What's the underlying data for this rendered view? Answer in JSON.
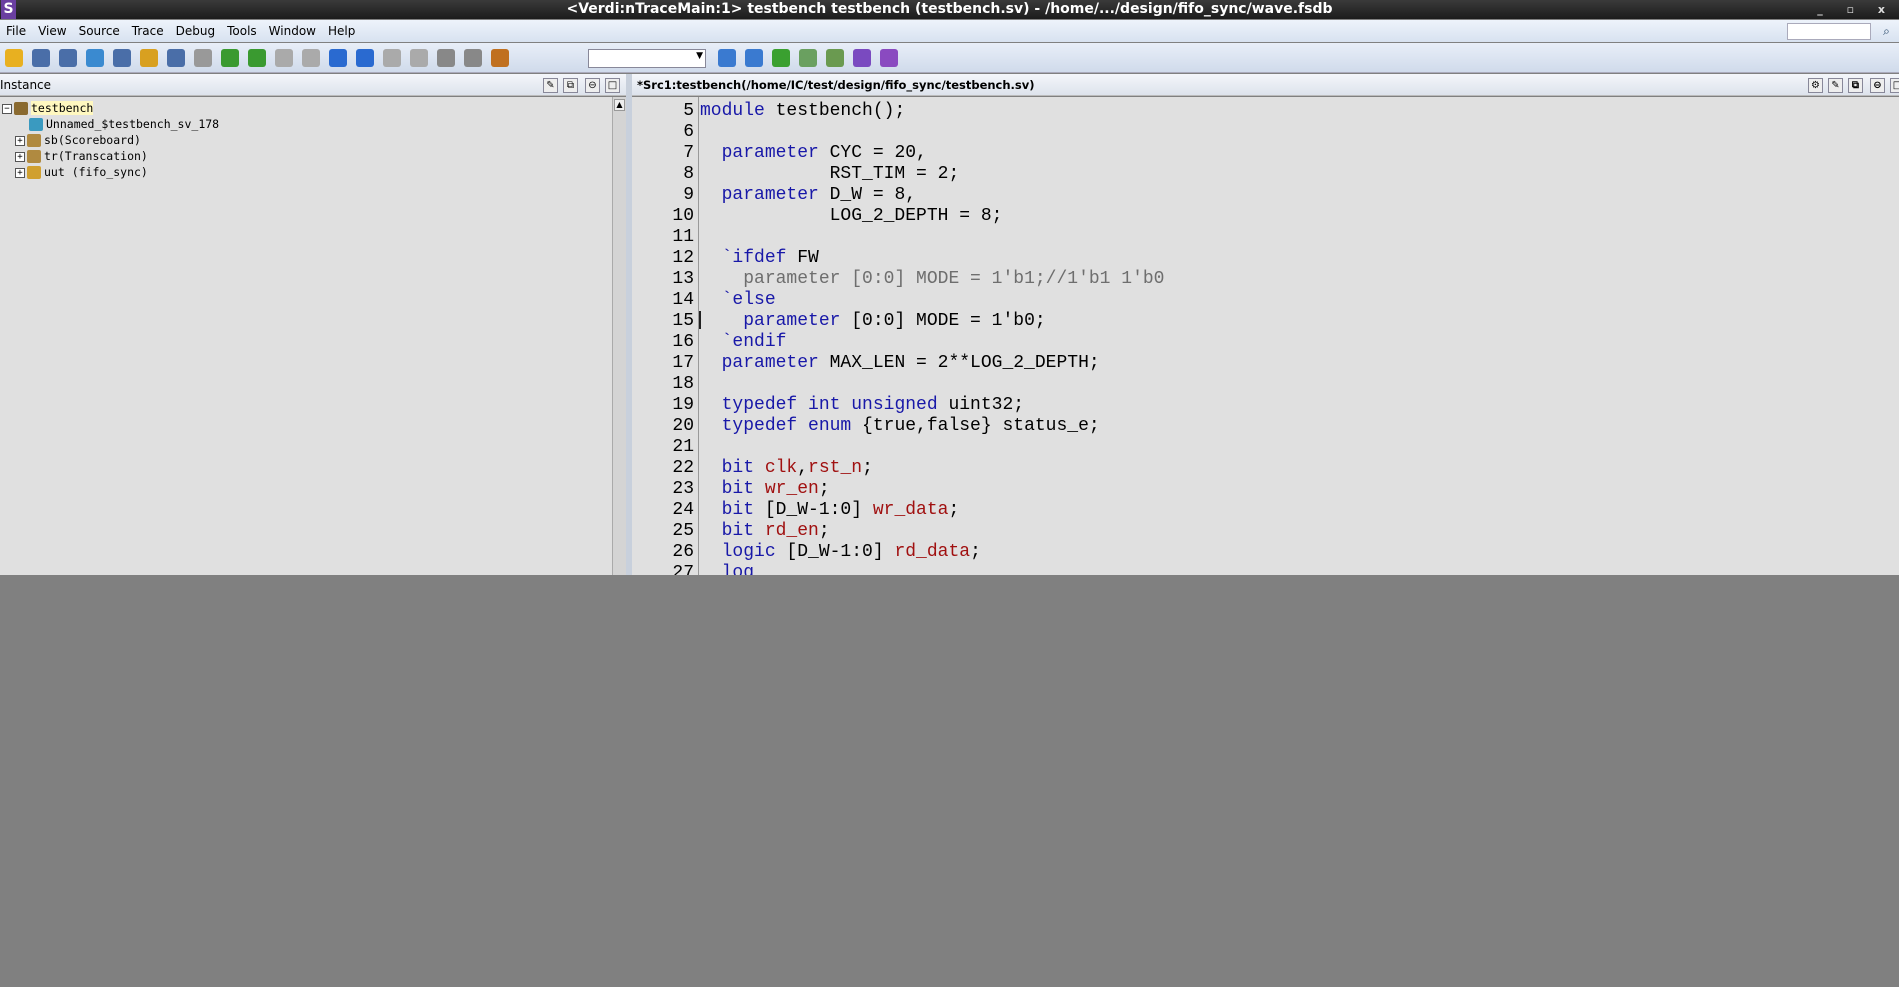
{
  "window": {
    "title": "<Verdi:nTraceMain:1> testbench testbench (testbench.sv) - /home/.../design/fifo_sync/wave.fsdb",
    "logo": "S"
  },
  "menu": [
    "File",
    "View",
    "Source",
    "Trace",
    "Debug",
    "Tools",
    "Window",
    "Help"
  ],
  "toolbar": {
    "icons": [
      "open-folder-icon",
      "schematic-icon",
      "design-icon",
      "hierarchy-icon",
      "notes-icon",
      "folder-icon",
      "edit-icon",
      "paste-icon",
      "trace-load-icon",
      "trace-driver-icon",
      "back-arrow-icon",
      "forward-arrow-icon",
      "driver-icon",
      "load-icon",
      "up-icon",
      "down-icon",
      "expand-icon",
      "collapse-icon",
      "bookmark-icon",
      "find-icon",
      "zoom-find-icon",
      "e-icon",
      "refresh-icon",
      "add-icon",
      "uvm-icon",
      "apps-icon"
    ],
    "combo_value": ""
  },
  "instance_panel": {
    "title": "Instance",
    "tree": [
      {
        "label": "testbench",
        "level": 0,
        "expander": "minus",
        "highlight": true
      },
      {
        "label": "Unnamed_$testbench_sv_178",
        "level": 1,
        "expander": "none"
      },
      {
        "label": "sb(Scoreboard)",
        "level": 1,
        "expander": "plus"
      },
      {
        "label": "tr(Transcation)",
        "level": 1,
        "expander": "plus"
      },
      {
        "label": "uut (fifo_sync)",
        "level": 1,
        "expander": "plus"
      }
    ]
  },
  "source_panel": {
    "title": "*Src1:testbench(/home/IC/test/design/fifo_sync/testbench.sv)",
    "lines": [
      {
        "n": "5",
        "tokens": [
          [
            "kw",
            "module"
          ],
          [
            "",
            "testbench();"
          ]
        ],
        "indent": 0,
        "sep": " "
      },
      {
        "n": "6",
        "tokens": [],
        "indent": 0
      },
      {
        "n": "7",
        "tokens": [
          [
            "kw",
            "parameter"
          ],
          [
            "",
            " CYC = 20,"
          ]
        ],
        "indent": 2
      },
      {
        "n": "8",
        "tokens": [
          [
            "",
            "RST_TIM = 2;"
          ]
        ],
        "indent": 12
      },
      {
        "n": "9",
        "tokens": [
          [
            "kw",
            "parameter"
          ],
          [
            "",
            " D_W = 8,"
          ]
        ],
        "indent": 2
      },
      {
        "n": "10",
        "tokens": [
          [
            "",
            "LOG_2_DEPTH = 8;"
          ]
        ],
        "indent": 12
      },
      {
        "n": "11",
        "tokens": [],
        "indent": 0
      },
      {
        "n": "12",
        "tokens": [
          [
            "kw",
            "`ifdef"
          ],
          [
            "",
            " FW"
          ]
        ],
        "indent": 2
      },
      {
        "n": "13",
        "tokens": [
          [
            "inact",
            "parameter [0:0] MODE = 1'b1;//1'b1 1'b0"
          ]
        ],
        "indent": 4
      },
      {
        "n": "14",
        "tokens": [
          [
            "kw",
            "`else"
          ]
        ],
        "indent": 2
      },
      {
        "n": "15",
        "tokens": [
          [
            "kw",
            "parameter"
          ],
          [
            "",
            " [0:0] MODE = 1'b0;"
          ]
        ],
        "indent": 4
      },
      {
        "n": "16",
        "tokens": [
          [
            "kw",
            "`endif"
          ]
        ],
        "indent": 2
      },
      {
        "n": "17",
        "tokens": [
          [
            "kw",
            "parameter"
          ],
          [
            "",
            " MAX_LEN = 2**LOG_2_DEPTH;"
          ]
        ],
        "indent": 2
      },
      {
        "n": "18",
        "tokens": [],
        "indent": 0
      },
      {
        "n": "19",
        "tokens": [
          [
            "kw",
            "typedef int unsigned"
          ],
          [
            "",
            " uint32;"
          ]
        ],
        "indent": 2
      },
      {
        "n": "20",
        "tokens": [
          [
            "kw",
            "typedef enum"
          ],
          [
            "",
            " {true,false} status_e;"
          ]
        ],
        "indent": 2
      },
      {
        "n": "21",
        "tokens": [],
        "indent": 0
      },
      {
        "n": "22",
        "tokens": [
          [
            "kw",
            "bit"
          ],
          [
            "",
            " "
          ],
          [
            "sig",
            "clk"
          ],
          [
            "",
            ","
          ],
          [
            "sig",
            "rst_n"
          ],
          [
            "",
            ";"
          ]
        ],
        "indent": 2
      },
      {
        "n": "23",
        "tokens": [
          [
            "kw",
            "bit"
          ],
          [
            "",
            " "
          ],
          [
            "sig",
            "wr_en"
          ],
          [
            "",
            ";"
          ]
        ],
        "indent": 2
      },
      {
        "n": "24",
        "tokens": [
          [
            "kw",
            "bit"
          ],
          [
            "",
            " [D_W-1:0] "
          ],
          [
            "sig",
            "wr_data"
          ],
          [
            "",
            ";"
          ]
        ],
        "indent": 2
      },
      {
        "n": "25",
        "tokens": [
          [
            "kw",
            "bit"
          ],
          [
            "",
            " "
          ],
          [
            "sig",
            "rd_en"
          ],
          [
            "",
            ";"
          ]
        ],
        "indent": 2
      },
      {
        "n": "26",
        "tokens": [
          [
            "kw",
            "logic"
          ],
          [
            "",
            " [D_W-1:0] "
          ],
          [
            "sig",
            "rd_data"
          ],
          [
            "",
            ";"
          ]
        ],
        "indent": 2
      },
      {
        "n": "27",
        "tokens": [
          [
            "kw",
            "log"
          ]
        ],
        "indent": 2
      }
    ]
  },
  "colors": {
    "keyword": "#1818a8",
    "signal": "#a01010",
    "inactive": "#6e6e6e",
    "background": "#e0e0e0",
    "desktop": "#808080"
  }
}
